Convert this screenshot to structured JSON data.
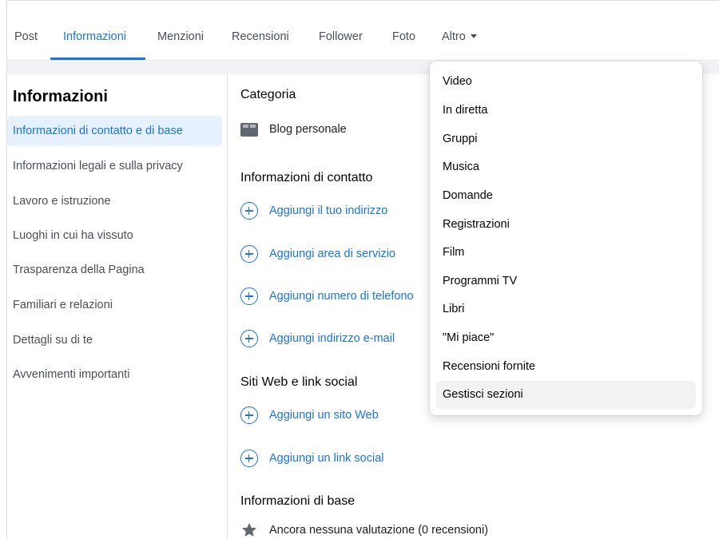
{
  "tabs": [
    {
      "label": "Post"
    },
    {
      "label": "Informazioni"
    },
    {
      "label": "Menzioni"
    },
    {
      "label": "Recensioni"
    },
    {
      "label": "Follower"
    },
    {
      "label": "Foto"
    },
    {
      "label": "Altro"
    }
  ],
  "active_tab": "Informazioni",
  "sidebar": {
    "title": "Informazioni",
    "items": [
      {
        "label": "Informazioni di contatto e di base"
      },
      {
        "label": "Informazioni legali e sulla privacy"
      },
      {
        "label": "Lavoro e istruzione"
      },
      {
        "label": "Luoghi in cui ha vissuto"
      },
      {
        "label": "Trasparenza della Pagina"
      },
      {
        "label": "Familiari e relazioni"
      },
      {
        "label": "Dettagli su di te"
      },
      {
        "label": "Avvenimenti importanti"
      }
    ]
  },
  "main": {
    "category_title": "Categoria",
    "category_value": "Blog personale",
    "contact_title": "Informazioni di contatto",
    "contact_links": [
      {
        "label": "Aggiungi il tuo indirizzo"
      },
      {
        "label": "Aggiungi area di servizio"
      },
      {
        "label": "Aggiungi numero di telefono"
      },
      {
        "label": "Aggiungi indirizzo e-mail"
      }
    ],
    "web_title": "Siti Web e link social",
    "web_links": [
      {
        "label": "Aggiungi un sito Web"
      },
      {
        "label": "Aggiungi un link social"
      }
    ],
    "basic_title": "Informazioni di base",
    "rating_text": "Ancora nessuna valutazione (0 recensioni)"
  },
  "dropdown": {
    "items": [
      {
        "label": "Video"
      },
      {
        "label": "In diretta"
      },
      {
        "label": "Gruppi"
      },
      {
        "label": "Musica"
      },
      {
        "label": "Domande"
      },
      {
        "label": "Registrazioni"
      },
      {
        "label": "Film"
      },
      {
        "label": "Programmi TV"
      },
      {
        "label": "Libri"
      },
      {
        "label": "\"Mi piace\""
      },
      {
        "label": "Recensioni fornite"
      },
      {
        "label": "Gestisci sezioni"
      }
    ],
    "highlighted": "Gestisci sezioni"
  },
  "colors": {
    "accent": "#1b74e4",
    "active_bg": "#e7f0fd",
    "page_bg": "#f0f2f5",
    "text": "#4b4f56"
  }
}
